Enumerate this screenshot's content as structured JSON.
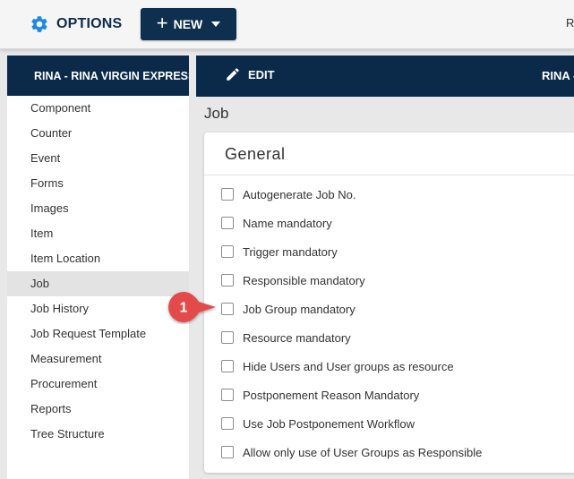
{
  "topbar": {
    "options_label": "OPTIONS",
    "new_button_label": "NEW",
    "user_initial": "R"
  },
  "sidebar": {
    "header": "RINA - RINA VIRGIN EXPRESS",
    "items": [
      {
        "label": "Component"
      },
      {
        "label": "Counter"
      },
      {
        "label": "Event"
      },
      {
        "label": "Forms"
      },
      {
        "label": "Images"
      },
      {
        "label": "Item"
      },
      {
        "label": "Item Location"
      },
      {
        "label": "Job",
        "active": true
      },
      {
        "label": "Job History"
      },
      {
        "label": "Job Request Template"
      },
      {
        "label": "Measurement"
      },
      {
        "label": "Procurement"
      },
      {
        "label": "Reports"
      },
      {
        "label": "Tree Structure"
      }
    ]
  },
  "content_header": {
    "edit_label": "EDIT",
    "right_label": "RINA -"
  },
  "page": {
    "title": "Job"
  },
  "card": {
    "title": "General",
    "checkboxes": [
      {
        "label": "Autogenerate Job No.",
        "checked": false
      },
      {
        "label": "Name mandatory",
        "checked": false
      },
      {
        "label": "Trigger mandatory",
        "checked": false
      },
      {
        "label": "Responsible mandatory",
        "checked": false
      },
      {
        "label": "Job Group mandatory",
        "checked": false
      },
      {
        "label": "Resource mandatory",
        "checked": false
      },
      {
        "label": "Hide Users and User groups as resource",
        "checked": false
      },
      {
        "label": "Postponement Reason Mandatory",
        "checked": false
      },
      {
        "label": "Use Job Postponement Workflow",
        "checked": false
      },
      {
        "label": "Allow only use of User Groups as Responsible",
        "checked": false
      }
    ]
  },
  "callout": {
    "number": "1",
    "color": "#e34b4b"
  },
  "colors": {
    "navy": "#0b2a4a",
    "gear_blue": "#1e88e5"
  }
}
